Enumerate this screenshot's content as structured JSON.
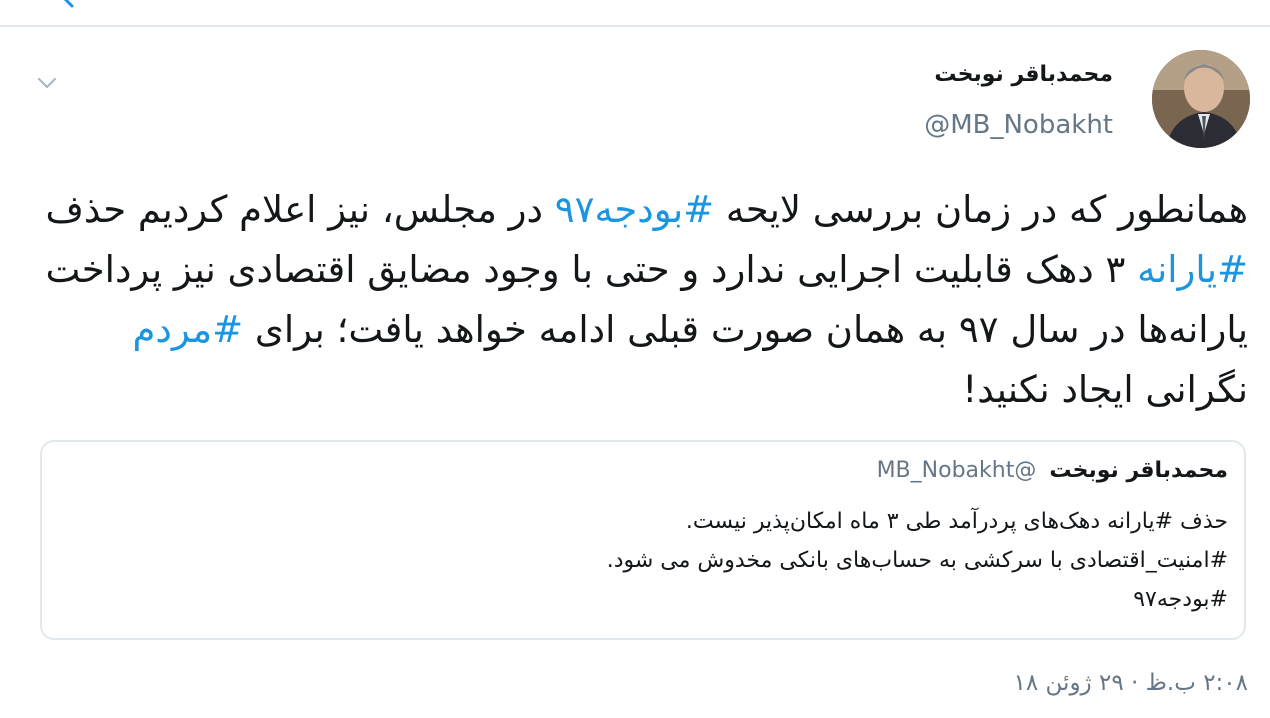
{
  "nav": {
    "back_icon": "arrow-left-icon",
    "menu_icon": "chevron-down-icon"
  },
  "tweet": {
    "author": {
      "display_name": "محمدباقر نوبخت",
      "handle": "@MB_Nobakht"
    },
    "body_segments": [
      {
        "text": "همانطور که در زمان بررسی لایحه ",
        "hashtag": false
      },
      {
        "text": "#بودجه۹۷",
        "hashtag": true
      },
      {
        "text": " در مجلس، نیز اعلام کردیم حذف ",
        "hashtag": false
      },
      {
        "text": "#یارانه",
        "hashtag": true
      },
      {
        "text": " ۳ دهک قابلیت اجرایی ندارد و حتی با وجود مضایق اقتصادی نیز پرداخت یارانه‌ها در سال ۹۷ به همان صورت قبلی ادامه خواهد یافت؛ برای ",
        "hashtag": false
      },
      {
        "text": "#مردم",
        "hashtag": true
      },
      {
        "text": " نگرانی ایجاد نکنید!",
        "hashtag": false
      }
    ],
    "timestamp": "۲:۰۸ ب.ظ · ۲۹ ژوئن ۱۸"
  },
  "quoted_tweet": {
    "display_name": "محمدباقر نوبخت",
    "handle": "@MB_Nobakht",
    "lines": [
      "حذف #یارانه دهک‌های پردرآمد طی ۳ ماه امکان‌پذیر نیست.",
      "#امنیت_اقتصادی با سرکشی به حساب‌های بانکی مخدوش می شود.",
      "#بودجه۹۷"
    ]
  },
  "colors": {
    "hashtag": "#1b95e0",
    "secondary_text": "#657786",
    "border": "#e1e8ed"
  }
}
